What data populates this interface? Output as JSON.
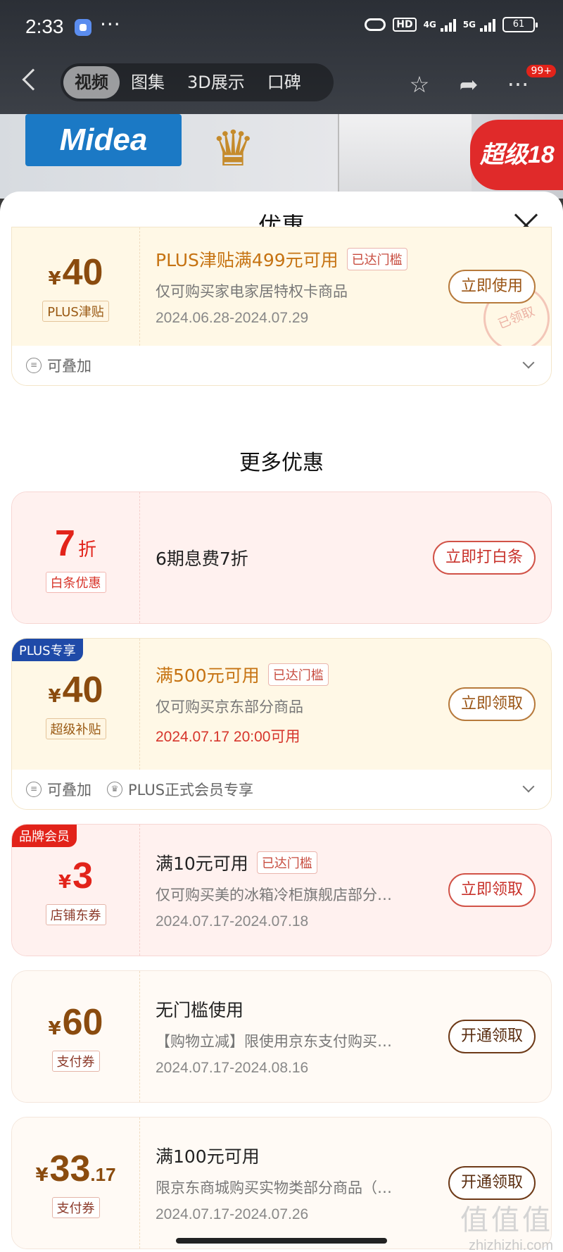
{
  "status": {
    "time": "2:33",
    "battery": "61",
    "net1": "4G",
    "net2": "5G",
    "hd": "HD"
  },
  "nav": {
    "tabs": [
      "视频",
      "图集",
      "3D展示",
      "口碑"
    ],
    "badge": "99+"
  },
  "hero": {
    "logo": "Midea",
    "promo": "超级18"
  },
  "sheet": {
    "title": "优惠",
    "section_title": "更多优惠"
  },
  "coupons": [
    {
      "currency": "¥",
      "amount": "40",
      "tag": "PLUS津贴",
      "title": "PLUS津贴满499元可用",
      "reach": "已达门槛",
      "desc": "仅可购买家电家居特权卡商品",
      "date": "2024.06.28-2024.07.29",
      "button": "立即使用",
      "stamp": "已领取",
      "foot": [
        "可叠加"
      ]
    },
    {
      "amount": "7",
      "suffix": "折",
      "tag": "白条优惠",
      "title": "6期息费7折",
      "button": "立即打白条"
    },
    {
      "corner": "PLUS专享",
      "currency": "¥",
      "amount": "40",
      "tag": "超级补贴",
      "title": "满500元可用",
      "reach": "已达门槛",
      "desc": "仅可购买京东部分商品",
      "date": "2024.07.17 20:00可用",
      "button": "立即领取",
      "foot": [
        "可叠加",
        "PLUS正式会员专享"
      ]
    },
    {
      "corner": "品牌会员",
      "currency": "¥",
      "amount": "3",
      "tag": "店铺东券",
      "title": "满10元可用",
      "reach": "已达门槛",
      "desc": "仅可购买美的冰箱冷柜旗舰店部分…",
      "date": "2024.07.17-2024.07.18",
      "button": "立即领取"
    },
    {
      "currency": "¥",
      "amount": "60",
      "tag": "支付券",
      "title": "无门槛使用",
      "desc": "【购物立减】限使用京东支付购买…",
      "date": "2024.07.17-2024.08.16",
      "button": "开通领取"
    },
    {
      "currency": "¥",
      "amount": "33",
      "decimal": ".17",
      "tag": "支付券",
      "title": "满100元可用",
      "desc": "限京东商城购买实物类部分商品（…",
      "date": "2024.07.17-2024.07.26",
      "button": "开通领取"
    }
  ],
  "watermark": {
    "big": "值值值",
    "small": "zhizhizhi.com"
  }
}
